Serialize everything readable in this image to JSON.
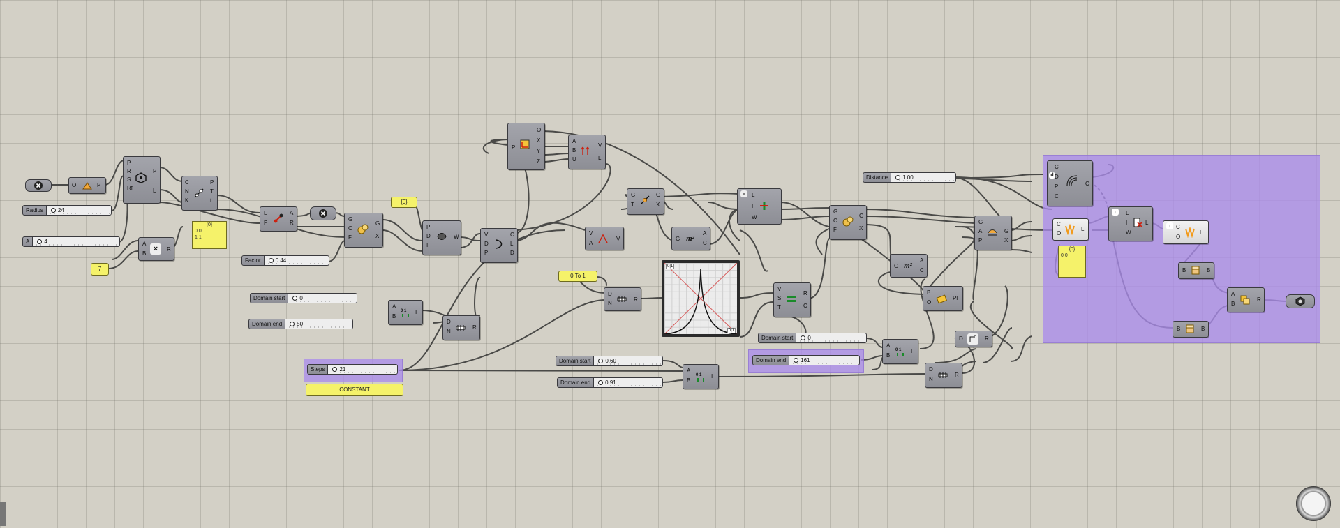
{
  "sliders": {
    "radius": {
      "label": "Radius",
      "value": "24"
    },
    "a": {
      "label": "A",
      "value": "4"
    },
    "factor": {
      "label": "Factor",
      "value": "0.44"
    },
    "domain_start_1": {
      "label": "Domain start",
      "value": "0"
    },
    "domain_end_1": {
      "label": "Domain end",
      "value": "50"
    },
    "steps": {
      "label": "Steps",
      "value": "21"
    },
    "domain_start_2": {
      "label": "Domain start",
      "value": "0.60"
    },
    "domain_end_2": {
      "label": "Domain end",
      "value": "0.91"
    },
    "domain_start_3": {
      "label": "Domain start",
      "value": "0"
    },
    "domain_end_3": {
      "label": "Domain end",
      "value": "161"
    },
    "distance": {
      "label": "Distance",
      "value": "1.00"
    }
  },
  "panels": {
    "p1": {
      "header": "{0}",
      "rows": [
        "0  0",
        "1  1"
      ]
    },
    "p2": {
      "header": "{0}",
      "rows": []
    },
    "p3": {
      "header": "{0}",
      "rows": [
        "0  0"
      ]
    },
    "range_label": "0 To 1",
    "constant_label": "CONSTANT",
    "small_num": "7"
  },
  "graph": {
    "top_left": "0|1",
    "bottom_right": "0|1"
  },
  "colors": {
    "canvas": "#d3d0c6",
    "component": "#97989f",
    "wire": "#4a4a48",
    "group": "#a98ee6",
    "panel": "#f5f26a"
  },
  "icons": [
    "cross-icon",
    "sphere-icon",
    "polygon-icon",
    "line-icon",
    "gradient-icon",
    "vector-icon",
    "plane-icon",
    "range-icon",
    "area-icon",
    "mirror-icon",
    "loft-icon",
    "curve-icon",
    "divide-icon",
    "dispatch-icon",
    "graph-mapper-icon",
    "navigation-wheel-icon"
  ]
}
